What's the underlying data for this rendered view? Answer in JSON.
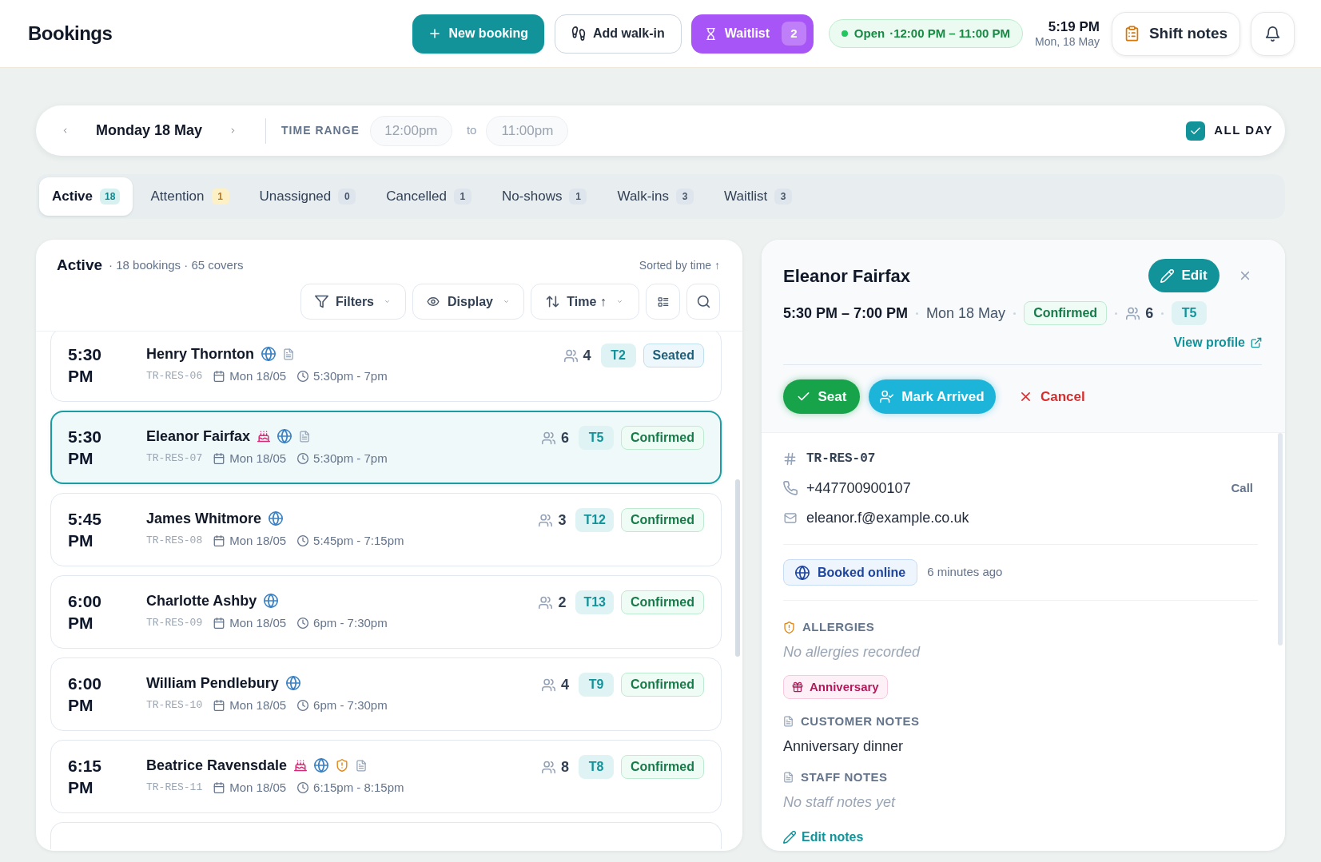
{
  "header": {
    "title": "Bookings",
    "new_booking": "New booking",
    "walk_in": "Add walk-in",
    "waitlist": {
      "label": "Waitlist",
      "count": "2"
    },
    "status": {
      "label": "Open",
      "hours": "·12:00 PM – 11:00 PM",
      "open": true
    },
    "clock": {
      "time": "5:19 PM",
      "date": "Mon, 18 May"
    },
    "shift_notes": "Shift notes"
  },
  "date_bar": {
    "date": "Monday 18 May",
    "time_range": {
      "label": "TIME RANGE",
      "from": "12:00pm",
      "to_label": "to",
      "to": "11:00pm",
      "disabled": true
    },
    "all_day": {
      "label": "ALL DAY",
      "checked": true
    }
  },
  "tabs": [
    {
      "label": "Active",
      "count": "18",
      "kind": "default",
      "selected": true
    },
    {
      "label": "Attention",
      "count": "1",
      "kind": "warning",
      "selected": false
    },
    {
      "label": "Unassigned",
      "count": "0",
      "kind": "default",
      "selected": false
    },
    {
      "label": "Cancelled",
      "count": "1",
      "kind": "default",
      "selected": false
    },
    {
      "label": "No-shows",
      "count": "1",
      "kind": "default",
      "selected": false
    },
    {
      "label": "Walk-ins",
      "count": "3",
      "kind": "default",
      "selected": false
    },
    {
      "label": "Waitlist",
      "count": "3",
      "kind": "default",
      "selected": false
    }
  ],
  "list": {
    "title": "Active",
    "summary": "· 18 bookings · 65 covers",
    "sort_note": "Sorted by time ↑",
    "filters": "Filters",
    "display": "Display",
    "sort": "Time ↑",
    "bookings": [
      {
        "time": "5:30 PM",
        "name": "Henry Thornton",
        "occasion": false,
        "online": true,
        "allergy": false,
        "notes": true,
        "reference": "TR-RES-06",
        "date": "Mon 18/05",
        "slot": "5:30pm - 7pm",
        "covers": "4",
        "table": "T2",
        "status": {
          "label": "Seated",
          "kind": "seated"
        },
        "selected": false
      },
      {
        "time": "5:30 PM",
        "name": "Eleanor Fairfax",
        "occasion": true,
        "online": true,
        "allergy": false,
        "notes": true,
        "reference": "TR-RES-07",
        "date": "Mon 18/05",
        "slot": "5:30pm - 7pm",
        "covers": "6",
        "table": "T5",
        "status": {
          "label": "Confirmed",
          "kind": "confirmed"
        },
        "selected": true
      },
      {
        "time": "5:45 PM",
        "name": "James Whitmore",
        "occasion": false,
        "online": true,
        "allergy": false,
        "notes": false,
        "reference": "TR-RES-08",
        "date": "Mon 18/05",
        "slot": "5:45pm - 7:15pm",
        "covers": "3",
        "table": "T12",
        "status": {
          "label": "Confirmed",
          "kind": "confirmed"
        },
        "selected": false
      },
      {
        "time": "6:00 PM",
        "name": "Charlotte Ashby",
        "occasion": false,
        "online": true,
        "allergy": false,
        "notes": false,
        "reference": "TR-RES-09",
        "date": "Mon 18/05",
        "slot": "6pm - 7:30pm",
        "covers": "2",
        "table": "T13",
        "status": {
          "label": "Confirmed",
          "kind": "confirmed"
        },
        "selected": false
      },
      {
        "time": "6:00 PM",
        "name": "William Pendlebury",
        "occasion": false,
        "online": true,
        "allergy": false,
        "notes": false,
        "reference": "TR-RES-10",
        "date": "Mon 18/05",
        "slot": "6pm - 7:30pm",
        "covers": "4",
        "table": "T9",
        "status": {
          "label": "Confirmed",
          "kind": "confirmed"
        },
        "selected": false
      },
      {
        "time": "6:15 PM",
        "name": "Beatrice Ravensdale",
        "occasion": true,
        "online": true,
        "allergy": true,
        "notes": true,
        "reference": "TR-RES-11",
        "date": "Mon 18/05",
        "slot": "6:15pm - 8:15pm",
        "covers": "8",
        "table": "T8",
        "status": {
          "label": "Confirmed",
          "kind": "confirmed"
        },
        "selected": false
      }
    ]
  },
  "detail": {
    "name": "Eleanor Fairfax",
    "edit": "Edit",
    "time": "5:30 PM – 7:00 PM",
    "date": "Mon 18 May",
    "status": {
      "label": "Confirmed",
      "kind": "confirmed"
    },
    "covers": "6",
    "table": "T5",
    "view_profile": "View profile",
    "actions": [
      {
        "label": "Seat",
        "kind": "seat"
      },
      {
        "label": "Mark Arrived",
        "kind": "arrive"
      },
      {
        "label": "Cancel",
        "kind": "cancel"
      }
    ],
    "contact": {
      "reference": "TR-RES-07",
      "phone": "+447700900107",
      "call": "Call",
      "email": "eleanor.f@example.co.uk"
    },
    "source": {
      "label": "Booked online",
      "time": "6 minutes ago"
    },
    "allergies": {
      "heading": "ALLERGIES",
      "text": "No allergies recorded",
      "empty": true
    },
    "occasion_tag": "Anniversary",
    "notes": [
      {
        "heading": "CUSTOMER NOTES",
        "text": "Anniversary dinner",
        "empty": false
      },
      {
        "heading": "STAFF NOTES",
        "text": "No staff notes yet",
        "empty": true
      }
    ],
    "edit_notes": "Edit notes"
  }
}
